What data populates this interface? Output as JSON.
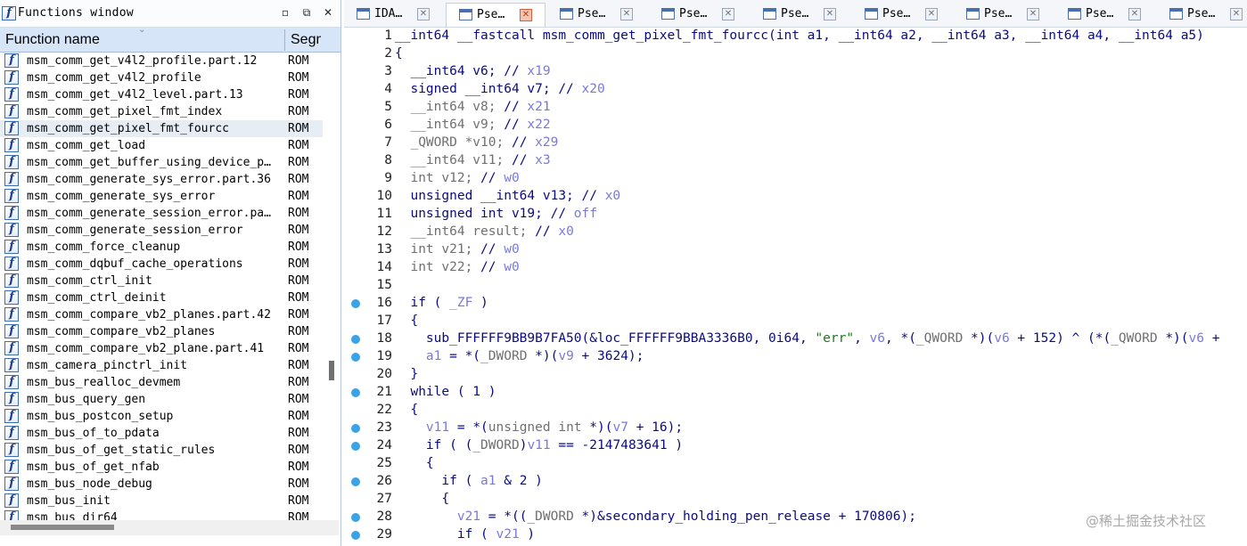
{
  "functions_window": {
    "title": "Functions window",
    "col_name": "Function name",
    "col_segment": "Segm",
    "selected_index": 4,
    "rows": [
      {
        "name": "msm_comm_get_v4l2_profile.part.12",
        "segment": "ROM"
      },
      {
        "name": "msm_comm_get_v4l2_profile",
        "segment": "ROM"
      },
      {
        "name": "msm_comm_get_v4l2_level.part.13",
        "segment": "ROM"
      },
      {
        "name": "msm_comm_get_pixel_fmt_index",
        "segment": "ROM"
      },
      {
        "name": "msm_comm_get_pixel_fmt_fourcc",
        "segment": "ROM"
      },
      {
        "name": "msm_comm_get_load",
        "segment": "ROM"
      },
      {
        "name": "msm_comm_get_buffer_using_device_p…",
        "segment": "ROM"
      },
      {
        "name": "msm_comm_generate_sys_error.part.36",
        "segment": "ROM"
      },
      {
        "name": "msm_comm_generate_sys_error",
        "segment": "ROM"
      },
      {
        "name": "msm_comm_generate_session_error.pa…",
        "segment": "ROM"
      },
      {
        "name": "msm_comm_generate_session_error",
        "segment": "ROM"
      },
      {
        "name": "msm_comm_force_cleanup",
        "segment": "ROM"
      },
      {
        "name": "msm_comm_dqbuf_cache_operations",
        "segment": "ROM"
      },
      {
        "name": "msm_comm_ctrl_init",
        "segment": "ROM"
      },
      {
        "name": "msm_comm_ctrl_deinit",
        "segment": "ROM"
      },
      {
        "name": "msm_comm_compare_vb2_planes.part.42",
        "segment": "ROM"
      },
      {
        "name": "msm_comm_compare_vb2_planes",
        "segment": "ROM"
      },
      {
        "name": "msm_comm_compare_vb2_plane.part.41",
        "segment": "ROM"
      },
      {
        "name": "msm_camera_pinctrl_init",
        "segment": "ROM"
      },
      {
        "name": "msm_bus_realloc_devmem",
        "segment": "ROM"
      },
      {
        "name": "msm_bus_query_gen",
        "segment": "ROM"
      },
      {
        "name": "msm_bus_postcon_setup",
        "segment": "ROM"
      },
      {
        "name": "msm_bus_of_to_pdata",
        "segment": "ROM"
      },
      {
        "name": "msm_bus_of_get_static_rules",
        "segment": "ROM"
      },
      {
        "name": "msm_bus_of_get_nfab",
        "segment": "ROM"
      },
      {
        "name": "msm_bus_node_debug",
        "segment": "ROM"
      },
      {
        "name": "msm_bus_init",
        "segment": "ROM"
      },
      {
        "name": "msm_bus_dir64",
        "segment": "ROM"
      }
    ]
  },
  "tabs": [
    {
      "label": "IDA…",
      "active": false
    },
    {
      "label": "Pse…",
      "active": true
    },
    {
      "label": "Pse…",
      "active": false
    },
    {
      "label": "Pse…",
      "active": false
    },
    {
      "label": "Pse…",
      "active": false
    },
    {
      "label": "Pse…",
      "active": false
    },
    {
      "label": "Pse…",
      "active": false
    },
    {
      "label": "Pse…",
      "active": false
    },
    {
      "label": "Pse…",
      "active": false
    }
  ],
  "code_lines": [
    {
      "n": "1",
      "bp": false,
      "html": "__int64 __fastcall msm_comm_get_pixel_fmt_fourcc(int a1, __int64 a2, __int64 a3, __int64 a4, __int64 a5)"
    },
    {
      "n": "2",
      "bp": false,
      "html": "{"
    },
    {
      "n": "3",
      "bp": false,
      "html": "  __int64 v6; // <span class=\"v\">x19</span>"
    },
    {
      "n": "4",
      "bp": false,
      "html": "  signed __int64 v7; // <span class=\"v\">x20</span>"
    },
    {
      "n": "5",
      "bp": false,
      "html": "  <span class=\"g\">__int64 v8;</span> // <span class=\"v\">x21</span>"
    },
    {
      "n": "6",
      "bp": false,
      "html": "  <span class=\"g\">__int64 v9;</span> // <span class=\"v\">x22</span>"
    },
    {
      "n": "7",
      "bp": false,
      "html": "  <span class=\"g\">_QWORD *v10;</span> // <span class=\"v\">x29</span>"
    },
    {
      "n": "8",
      "bp": false,
      "html": "  <span class=\"g\">__int64 v11;</span> // <span class=\"v\">x3</span>"
    },
    {
      "n": "9",
      "bp": false,
      "html": "  <span class=\"g\">int v12;</span> // <span class=\"v\">w0</span>"
    },
    {
      "n": "10",
      "bp": false,
      "html": "  unsigned __int64 v13; // <span class=\"v\">x0</span>"
    },
    {
      "n": "11",
      "bp": false,
      "html": "  unsigned int v19; // <span class=\"v\">off</span>"
    },
    {
      "n": "12",
      "bp": false,
      "html": "  <span class=\"g\">__int64 result;</span> // <span class=\"v\">x0</span>"
    },
    {
      "n": "13",
      "bp": false,
      "html": "  <span class=\"g\">int v21;</span> // <span class=\"v\">w0</span>"
    },
    {
      "n": "14",
      "bp": false,
      "html": "  <span class=\"g\">int v22;</span> // <span class=\"v\">w0</span>"
    },
    {
      "n": "15",
      "bp": false,
      "html": ""
    },
    {
      "n": "16",
      "bp": true,
      "html": "  if ( <span class=\"v\">_ZF</span> )"
    },
    {
      "n": "17",
      "bp": false,
      "html": "  {"
    },
    {
      "n": "18",
      "bp": true,
      "html": "    sub_FFFFFF9BB9B7FA50(&amp;loc_FFFFFF9BBA3336B0, 0i64, <span class=\"s\">\"err\"</span>, <span class=\"v\">v6</span>, *(<span class=\"g\">_QWORD</span> *)(<span class=\"v\">v6</span> + 152) ^ (*(<span class=\"g\">_QWORD</span> *)(<span class=\"v\">v6</span> +"
    },
    {
      "n": "19",
      "bp": true,
      "html": "    <span class=\"v\">a1</span> = *(<span class=\"g\">_DWORD</span> *)(<span class=\"v\">v9</span> + 3624);"
    },
    {
      "n": "20",
      "bp": false,
      "html": "  }"
    },
    {
      "n": "21",
      "bp": true,
      "html": "  while ( 1 )"
    },
    {
      "n": "22",
      "bp": false,
      "html": "  {"
    },
    {
      "n": "23",
      "bp": true,
      "html": "    <span class=\"v\">v11</span> = *(<span class=\"g\">unsigned int</span> *)(<span class=\"v\">v7</span> + 16);"
    },
    {
      "n": "24",
      "bp": true,
      "html": "    if ( (<span class=\"g\">_DWORD</span>)<span class=\"v\">v11</span> == -2147483641 )"
    },
    {
      "n": "25",
      "bp": false,
      "html": "    {"
    },
    {
      "n": "26",
      "bp": true,
      "html": "      if ( <span class=\"v\">a1</span> &amp; 2 )"
    },
    {
      "n": "27",
      "bp": false,
      "html": "      {"
    },
    {
      "n": "28",
      "bp": true,
      "html": "        <span class=\"v\">v21</span> = *((<span class=\"g\">_DWORD</span> *)&amp;secondary_holding_pen_release + 170806);"
    },
    {
      "n": "29",
      "bp": true,
      "html": "        if ( <span class=\"v\">v21</span> )"
    }
  ],
  "watermark": "@稀土掘金技术社区"
}
